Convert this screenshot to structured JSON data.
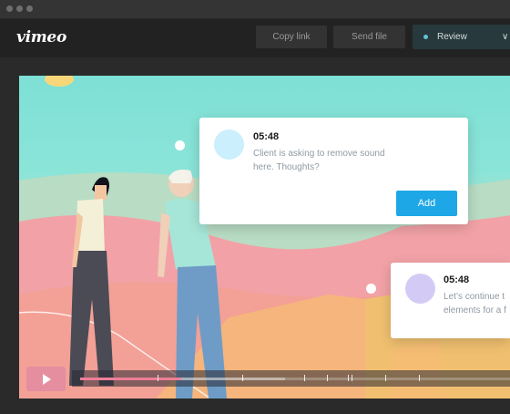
{
  "window": {
    "traffic_lights": [
      "close",
      "minimize",
      "maximize"
    ]
  },
  "topbar": {
    "logo": "vimeo",
    "copy_link_label": "Copy link",
    "send_file_label": "Send file",
    "review": {
      "label": "Review",
      "status_color": "#5ec4d6",
      "icon": "chevron-down-icon"
    }
  },
  "comments": [
    {
      "timestamp": "05:48",
      "text_line1": "Client is asking to remove sound",
      "text_line2": "here. Thoughts?",
      "avatar_color": "#cbeffc",
      "add_label": "Add"
    },
    {
      "timestamp": "05:48",
      "text_line1": "Let’s continue t",
      "text_line2": "elements for a f",
      "avatar_color": "#d3cbf5"
    }
  ],
  "player": {
    "play_icon": "play-icon",
    "progress": 0.225,
    "buffered": 0.456,
    "accent_color": "#ee7f99"
  },
  "colors": {
    "accent": "#1ea7e6",
    "background": "#2a2a2a"
  }
}
